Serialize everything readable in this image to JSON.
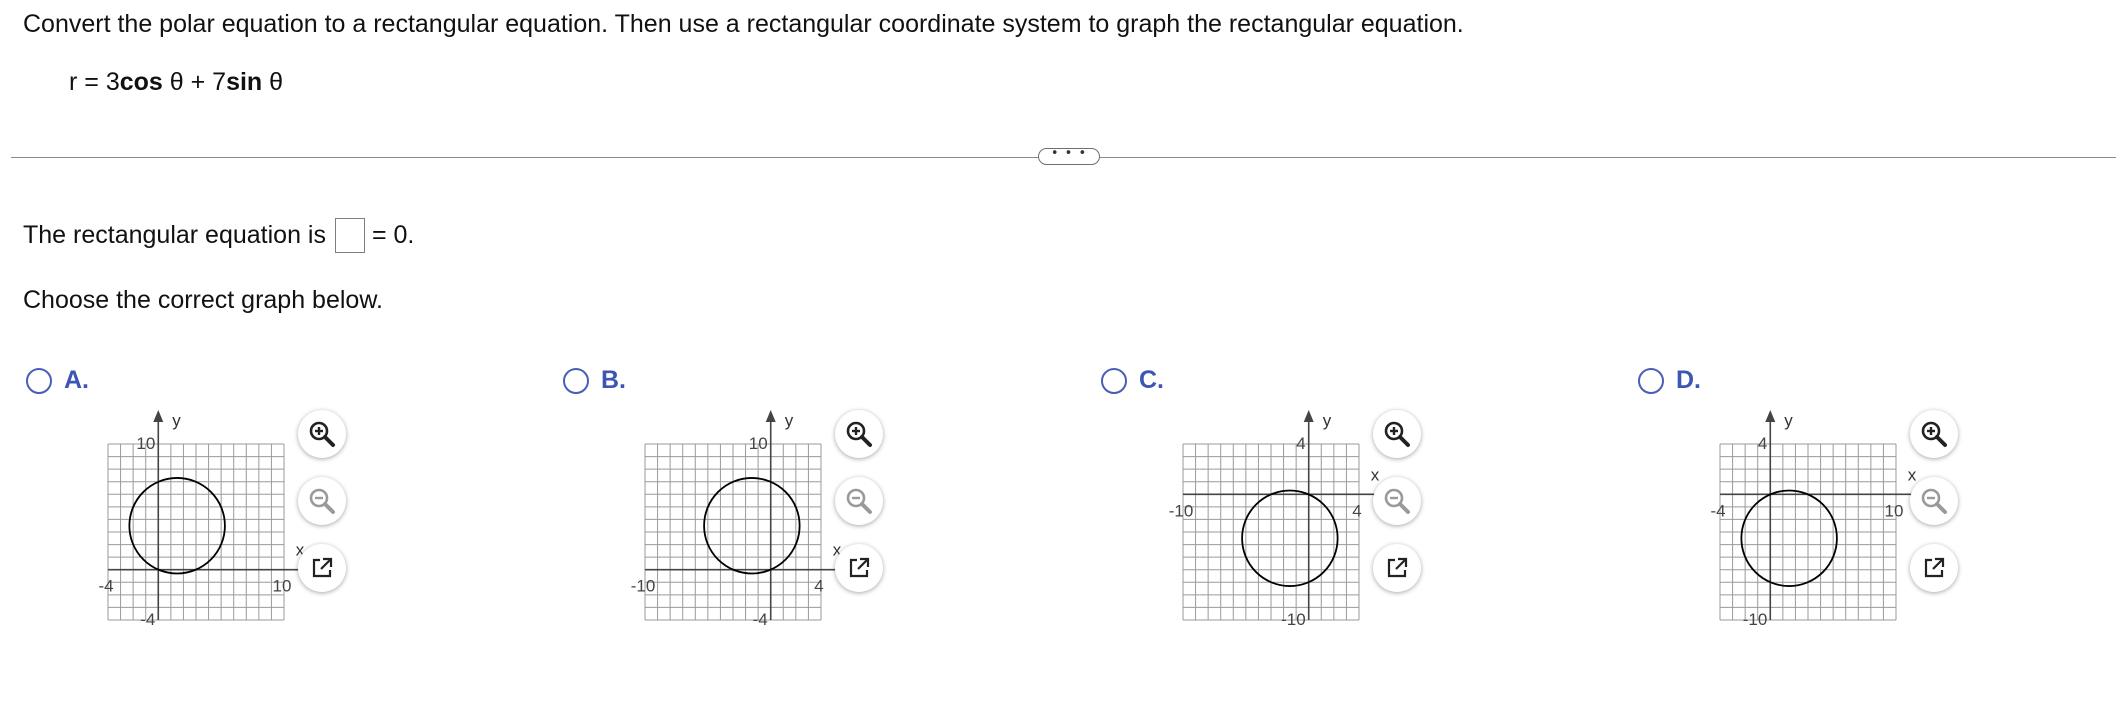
{
  "question": {
    "text": "Convert the polar equation to a rectangular equation. Then use a rectangular coordinate system to graph the rectangular equation.",
    "equation": {
      "prefix": "r = 3",
      "cos": "cos",
      "mid": " θ + 7",
      "sin": "sin",
      "suffix": " θ"
    }
  },
  "expand_button": {
    "label": "• • •"
  },
  "answer": {
    "prefix": "The rectangular equation is",
    "input_value": "",
    "suffix": "= 0."
  },
  "choose_text": "Choose the correct graph below.",
  "options": [
    {
      "label": "A.",
      "graph": {
        "x_range": [
          -4,
          10
        ],
        "y_range": [
          -4,
          10
        ],
        "x_tick_labels": [
          "-4",
          "10"
        ],
        "y_tick_labels": [
          "-4",
          "10"
        ],
        "x_axis_label": "x",
        "y_axis_label": "y",
        "circle": {
          "cx": 1.5,
          "cy": 3.5,
          "r": 3.8
        }
      }
    },
    {
      "label": "B.",
      "graph": {
        "x_range": [
          -10,
          4
        ],
        "y_range": [
          -4,
          10
        ],
        "x_tick_labels": [
          "-10",
          "4"
        ],
        "y_tick_labels": [
          "-4",
          "10"
        ],
        "x_axis_label": "x",
        "y_axis_label": "y",
        "circle": {
          "cx": -1.5,
          "cy": 3.5,
          "r": 3.8
        }
      }
    },
    {
      "label": "C.",
      "graph": {
        "x_range": [
          -10,
          4
        ],
        "y_range": [
          -10,
          4
        ],
        "x_tick_labels": [
          "-10",
          "4"
        ],
        "y_tick_labels": [
          "-10",
          "4"
        ],
        "x_axis_label": "x",
        "y_axis_label": "y",
        "circle": {
          "cx": -1.5,
          "cy": -3.5,
          "r": 3.8
        }
      }
    },
    {
      "label": "D.",
      "graph": {
        "x_range": [
          -4,
          10
        ],
        "y_range": [
          -10,
          4
        ],
        "x_tick_labels": [
          "-4",
          "10"
        ],
        "y_tick_labels": [
          "-10",
          "4"
        ],
        "x_axis_label": "x",
        "y_axis_label": "y",
        "circle": {
          "cx": 1.5,
          "cy": -3.5,
          "r": 3.8
        }
      }
    }
  ],
  "tools": {
    "zoom_in": "zoom-in-icon",
    "zoom_out": "zoom-out-icon",
    "popout": "popout-icon"
  },
  "colors": {
    "grid": "#9a9a9a",
    "axis": "#444444",
    "curve": "#000000",
    "option_label": "#3d55b3",
    "radio": "#4a5db8"
  }
}
